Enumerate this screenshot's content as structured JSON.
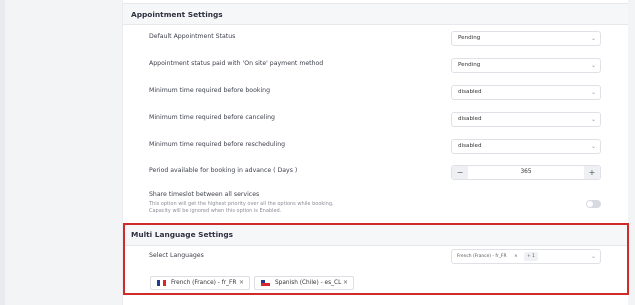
{
  "appointment_settings": {
    "title": "Appointment Settings",
    "rows": [
      {
        "label": "Default Appointment Status",
        "value": "Pending"
      },
      {
        "label": "Appointment status paid with 'On site' payment method",
        "value": "Pending"
      },
      {
        "label": "Minimum time required before booking",
        "value": "disabled"
      },
      {
        "label": "Minimum time required before canceling",
        "value": "disabled"
      },
      {
        "label": "Minimum time required before rescheduling",
        "value": "disabled"
      }
    ],
    "advance_booking": {
      "label": "Period available for booking in advance ( Days )",
      "minus": "−",
      "value": "365",
      "plus": "+"
    },
    "share_timeslot": {
      "label": "Share timeslot between all services",
      "help_line1": "This option will get the highest priority over all the options while booking.",
      "help_line2": "Capacity will be ignored when this option is Enabled."
    }
  },
  "multi_language": {
    "title": "Multi Language Settings",
    "select_label": "Select Languages",
    "select_preview": "French (France) - fr_FR",
    "select_preview_x": "×",
    "select_more": "+ 1",
    "chips": [
      {
        "label": "French (France) - fr_FR",
        "remove": "×"
      },
      {
        "label": "Spanish (Chile) - es_CL",
        "remove": "×"
      }
    ]
  },
  "colors": {
    "highlight_border": "#d02b2b",
    "section_bg": "#f6f7f9"
  },
  "icons": {
    "chevron": "chevron-down-icon",
    "flags": [
      "flag-france-icon",
      "flag-chile-icon"
    ]
  }
}
